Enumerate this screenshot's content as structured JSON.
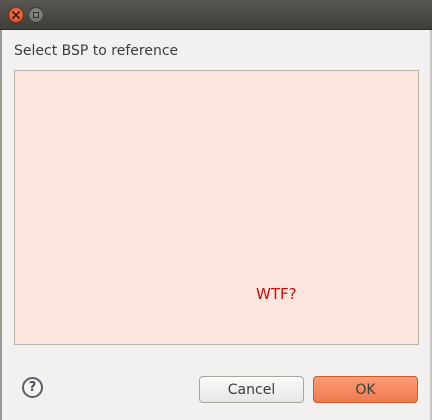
{
  "window": {
    "controls": {
      "close_icon": "close-icon",
      "maximize_icon": "maximize-icon"
    }
  },
  "dialog": {
    "heading": "Select BSP to reference",
    "list_text": "WTF?",
    "help_label": "?",
    "cancel_label": "Cancel",
    "ok_label": "OK"
  },
  "colors": {
    "list_background": "#fce5dd",
    "accent": "#f07a4f",
    "warning_text": "#c01010"
  }
}
